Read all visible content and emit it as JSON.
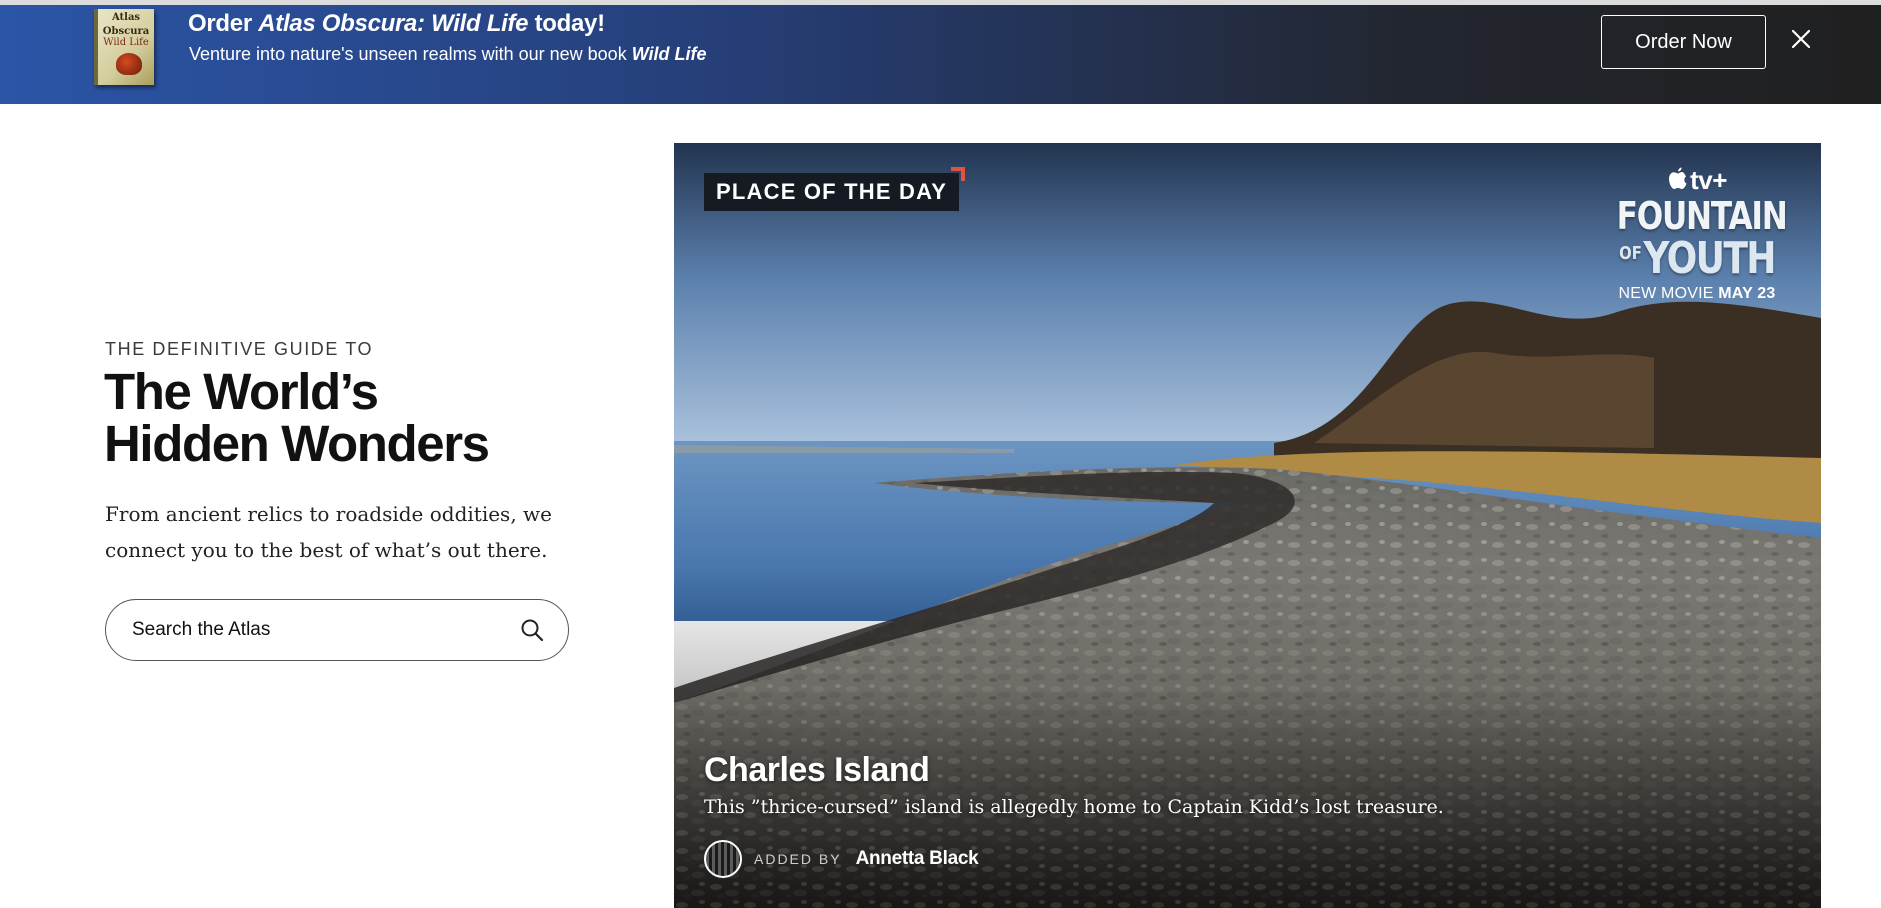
{
  "banner": {
    "book_cover": {
      "line1": "Atlas",
      "line2": "Obscura",
      "line3": "Wild Life"
    },
    "title_prefix": "Order ",
    "title_italic": "Atlas Obscura: Wild Life",
    "title_suffix": " today!",
    "subtitle_prefix": "Venture into nature's unseen realms with our new book ",
    "subtitle_italic": "Wild Life",
    "order_button": "Order Now",
    "close_icon": "close-icon"
  },
  "hero": {
    "eyebrow": "THE DEFINITIVE GUIDE TO",
    "headline_line1": "The World’s",
    "headline_line2": "Hidden Wonders",
    "lede_line1": "From ancient relics to roadside oddities, we",
    "lede_line2": "connect you to the best of what’s out there.",
    "search": {
      "placeholder": "Search the Atlas",
      "value": "",
      "icon": "search-icon"
    }
  },
  "place_of_day": {
    "badge": "PLACE OF THE DAY",
    "promo": {
      "network": "tv+",
      "title_line1": "FOUNTAIN",
      "title_of": "OF",
      "title_line2": "YOUTH",
      "release_prefix": "NEW MOVIE ",
      "release_date": "MAY 23"
    },
    "title": "Charles Island",
    "description": "This ”thrice-cursed” island is allegedly home to Captain Kidd’s lost treasure.",
    "added_by_label": "ADDED BY",
    "author": "Annetta Black"
  },
  "colors": {
    "banner_start": "#2b55a7",
    "banner_end": "#202020",
    "badge_bg": "#161a22",
    "badge_accent": "#e2533d",
    "text_dark": "#111111"
  }
}
